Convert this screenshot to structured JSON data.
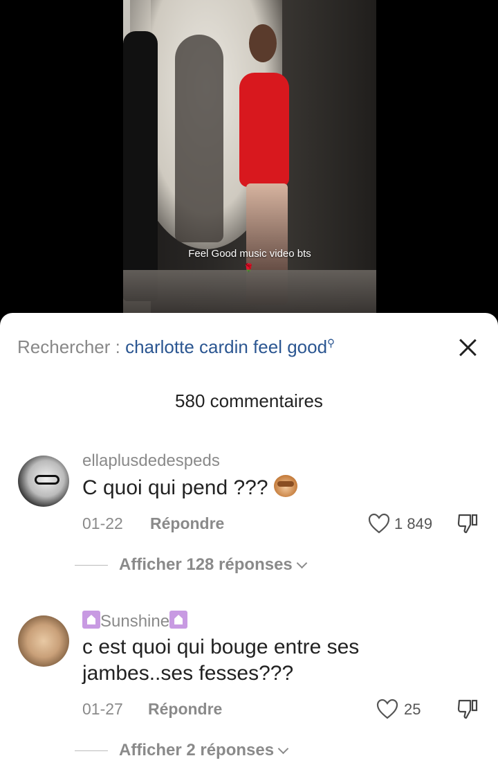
{
  "video": {
    "caption": "Feel Good music video bts"
  },
  "search": {
    "prefix": "Rechercher : ",
    "query": "charlotte cardin feel good"
  },
  "comments_count": "580 commentaires",
  "comments": [
    {
      "username": "ellaplusdedespeds",
      "text": "C quoi qui pend ???",
      "emoji": "see-no-evil-monkey",
      "date": "01-22",
      "reply_label": "Répondre",
      "likes": "1 849",
      "replies_label": "Afficher 128 réponses"
    },
    {
      "username": "Sunshine",
      "text": "c est quoi qui bouge entre ses jambes..ses fesses???",
      "date": "01-27",
      "reply_label": "Répondre",
      "likes": "25",
      "replies_label": "Afficher 2 réponses"
    }
  ],
  "colors": {
    "query": "#2b5691",
    "muted": "#8a8a8a",
    "text": "#222222"
  }
}
